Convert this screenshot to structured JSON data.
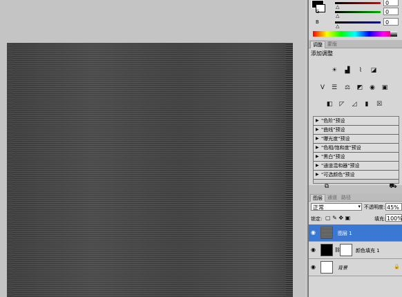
{
  "colors": {
    "accent": "#3b78d4",
    "canvas_fill": "#454545"
  },
  "color_panel": {
    "sliders": [
      {
        "label": "",
        "value": "0",
        "color": "#e00000"
      },
      {
        "label": "G",
        "value": "0",
        "color": "#00b000"
      },
      {
        "label": "B",
        "value": "0",
        "color": "#0000c0"
      }
    ]
  },
  "adjustments": {
    "tabs": [
      "调整",
      "蒙版"
    ],
    "title": "添加调整",
    "presets": [
      "\"色阶\"预设",
      "\"曲线\"预设",
      "\"曝光度\"预设",
      "\"色相/饱和度\"预设",
      "\"黑白\"预设",
      "\"通道混和器\"预设",
      "\"可选颜色\"预设"
    ]
  },
  "layers": {
    "tabs": [
      "图层",
      "通道",
      "路径"
    ],
    "blend_mode": "正常",
    "opacity_label": "不透明度:",
    "opacity": "45%",
    "lock_label": "锁定:",
    "fill_label": "填充:",
    "fill": "100%",
    "items": [
      {
        "name": "图层 1",
        "selected": true
      },
      {
        "name": "颜色填充 1",
        "selected": false
      },
      {
        "name": "背景",
        "selected": false
      }
    ]
  }
}
